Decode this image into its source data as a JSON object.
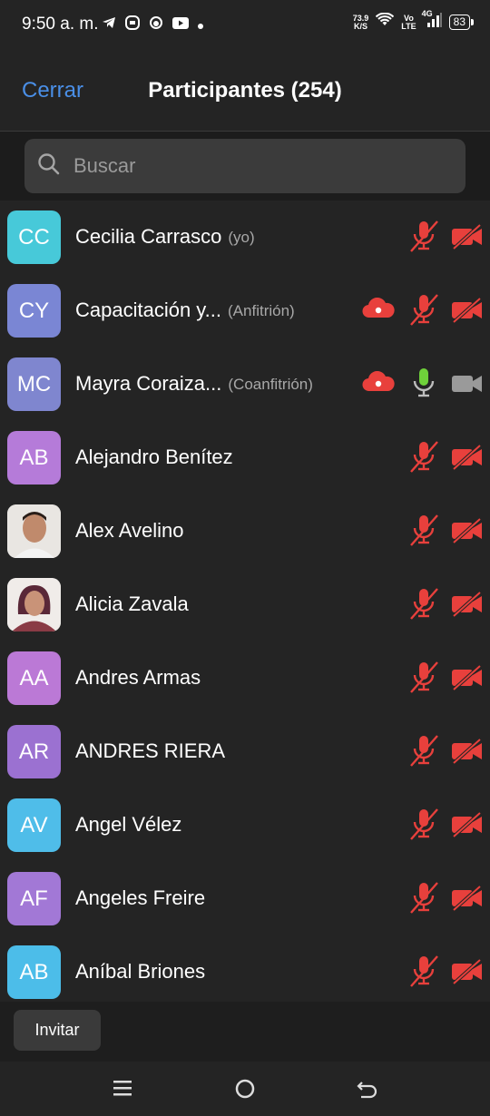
{
  "status_bar": {
    "time": "9:50 a. m.",
    "speed_value": "73.9",
    "speed_unit": "K/S",
    "volte_top": "Vo",
    "volte_bottom": "LTE",
    "network": "4G",
    "battery": "83"
  },
  "header": {
    "close_label": "Cerrar",
    "title": "Participantes (254)"
  },
  "search": {
    "placeholder": "Buscar"
  },
  "colors": {
    "accent": "#4a8fe7",
    "muted_red": "#e8403c",
    "mic_green": "#6fd13a"
  },
  "participants": [
    {
      "initials": "CC",
      "name": "Cecilia Carrasco",
      "role": "(yo)",
      "avatar_color": "#47c9d9",
      "cloud": false,
      "mic": "muted",
      "video": "off"
    },
    {
      "initials": "CY",
      "name": "Capacitación y...",
      "role": "(Anfitrión)",
      "avatar_color": "#7a86d4",
      "cloud": true,
      "mic": "muted",
      "video": "off"
    },
    {
      "initials": "MC",
      "name": "Mayra Coraiza...",
      "role": "(Coanfitrión)",
      "avatar_color": "#7f86cf",
      "cloud": true,
      "mic": "on",
      "video": "on"
    },
    {
      "initials": "AB",
      "name": "Alejandro Benítez",
      "role": "",
      "avatar_color": "#b57bd9",
      "cloud": false,
      "mic": "muted",
      "video": "off"
    },
    {
      "initials": "",
      "name": "Alex Avelino",
      "role": "",
      "avatar_color": "#cfcfcf",
      "cloud": false,
      "mic": "muted",
      "video": "off",
      "photo": "male"
    },
    {
      "initials": "",
      "name": "Alicia Zavala",
      "role": "",
      "avatar_color": "#cfcfcf",
      "cloud": false,
      "mic": "muted",
      "video": "off",
      "photo": "female"
    },
    {
      "initials": "AA",
      "name": "Andres Armas",
      "role": "",
      "avatar_color": "#bb79d6",
      "cloud": false,
      "mic": "muted",
      "video": "off"
    },
    {
      "initials": "AR",
      "name": "ANDRES RIERA",
      "role": "",
      "avatar_color": "#9b71d1",
      "cloud": false,
      "mic": "muted",
      "video": "off"
    },
    {
      "initials": "AV",
      "name": "Angel Vélez",
      "role": "",
      "avatar_color": "#4fbde9",
      "cloud": false,
      "mic": "muted",
      "video": "off"
    },
    {
      "initials": "AF",
      "name": "Angeles Freire",
      "role": "",
      "avatar_color": "#a278d6",
      "cloud": false,
      "mic": "muted",
      "video": "off"
    },
    {
      "initials": "AB",
      "name": "Aníbal Briones",
      "role": "",
      "avatar_color": "#4cbde9",
      "cloud": false,
      "mic": "muted",
      "video": "off"
    }
  ],
  "footer": {
    "invite_label": "Invitar"
  }
}
